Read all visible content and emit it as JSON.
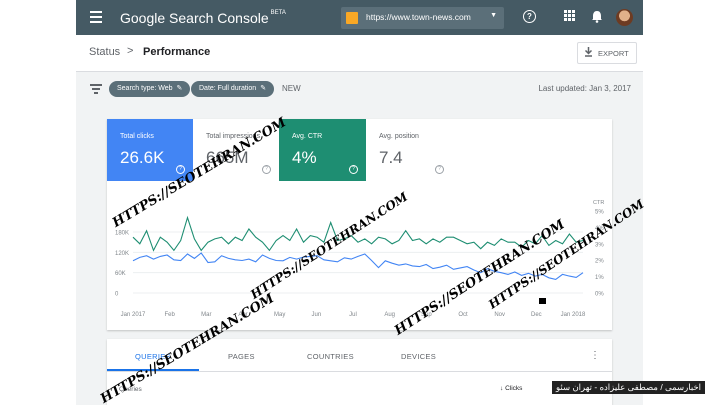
{
  "app": {
    "title": "Google Search Console",
    "beta": "BETA",
    "property_url": "https://www.town-news.com",
    "help_glyph": "?",
    "apps_glyph": "⋮⋮⋮",
    "bell_glyph": "🔔"
  },
  "breadcrumb": {
    "parent": "Status",
    "separator": ">",
    "current": "Performance"
  },
  "export_label": "EXPORT",
  "filters": {
    "search_type": "Search type: Web",
    "date": "Date: Full duration",
    "new_label": "NEW",
    "last_updated": "Last updated: Jan 3, 2017"
  },
  "metrics": [
    {
      "label": "Total clicks",
      "value": "26.6K"
    },
    {
      "label": "Total impressions",
      "value": "665M"
    },
    {
      "label": "Avg. CTR",
      "value": "4%"
    },
    {
      "label": "Avg. position",
      "value": "7.4"
    }
  ],
  "colors": {
    "clicks": "#4285f4",
    "ctr": "#1e8e72",
    "topbar": "#455a64"
  },
  "chart_data": {
    "type": "line",
    "x_ticks": [
      "Jan 2017",
      "Feb",
      "Mar",
      "Apr",
      "May",
      "Jun",
      "Jul",
      "Aug",
      "Sep",
      "Oct",
      "Nov",
      "Dec",
      "Jan 2018"
    ],
    "y_left_ticks": [
      "180K",
      "120K",
      "60K",
      "0"
    ],
    "y_left_range": [
      0,
      180000
    ],
    "y_right_title": "CTR",
    "y_right_ticks": [
      "5%",
      "4%",
      "3%",
      "2%",
      "1%",
      "0%"
    ],
    "y_right_range": [
      0,
      5
    ],
    "grid": true,
    "series": [
      {
        "name": "Clicks",
        "color": "#4285f4",
        "values": [
          95000,
          105000,
          110000,
          100000,
          108000,
          112000,
          98000,
          96000,
          115000,
          102000,
          118000,
          90000,
          92000,
          110000,
          102000,
          98000,
          96000,
          100000,
          92000,
          112000,
          102000,
          96000,
          95000,
          105000,
          100000,
          106000,
          108000,
          110000,
          98000,
          95000,
          92000,
          104000,
          100000,
          108000,
          115000,
          96000,
          75000,
          95000,
          88000,
          82000,
          86000,
          80000,
          78000,
          84000,
          72000,
          76000,
          82000,
          70000,
          74000,
          78000,
          68000,
          60000,
          72000,
          64000,
          60000,
          55000,
          62000,
          52000,
          58000,
          50000,
          55000,
          45000,
          40000,
          55000,
          50000,
          46000,
          60000
        ]
      },
      {
        "name": "CTR",
        "color": "#1e8e72",
        "values": [
          3.4,
          3.0,
          3.8,
          2.6,
          3.4,
          3.1,
          2.6,
          3.2,
          4.6,
          3.3,
          2.6,
          3.1,
          3.3,
          3.4,
          3.0,
          3.4,
          3.2,
          3.9,
          3.4,
          3.1,
          2.6,
          3.2,
          3.5,
          3.2,
          3.9,
          3.1,
          3.5,
          3.4,
          3.1,
          4.3,
          3.2,
          3.3,
          3.5,
          3.1,
          3.3,
          3.0,
          3.4,
          3.3,
          3.0,
          3.2,
          3.8,
          3.2,
          3.3,
          3.0,
          3.3,
          3.1,
          3.4,
          3.4,
          3.2,
          3.0,
          3.1,
          2.7,
          3.1,
          2.9,
          3.3,
          3.1,
          3.1,
          2.8,
          3.2,
          3.0,
          3.5,
          2.9,
          3.2,
          3.0,
          3.6,
          3.1,
          3.2
        ]
      }
    ]
  },
  "tabs": [
    "QUERIES",
    "PAGES",
    "COUNTRIES",
    "DEVICES"
  ],
  "table": {
    "col_queries": "Queries",
    "col_clicks": "Clicks"
  },
  "watermarks": [
    "HTTPS://SEOTEHRAN.COM",
    "HTTPS://SEOTEHRAN.COM",
    "HTTPS://SEOTEHRAN.COM",
    "HTTPS://SEOTEHRAN.COM",
    "HTTPS://SEOTEHRAN.COM"
  ],
  "caption": "اخبارسمی / مصطفی علیزاده - تهران سئو"
}
